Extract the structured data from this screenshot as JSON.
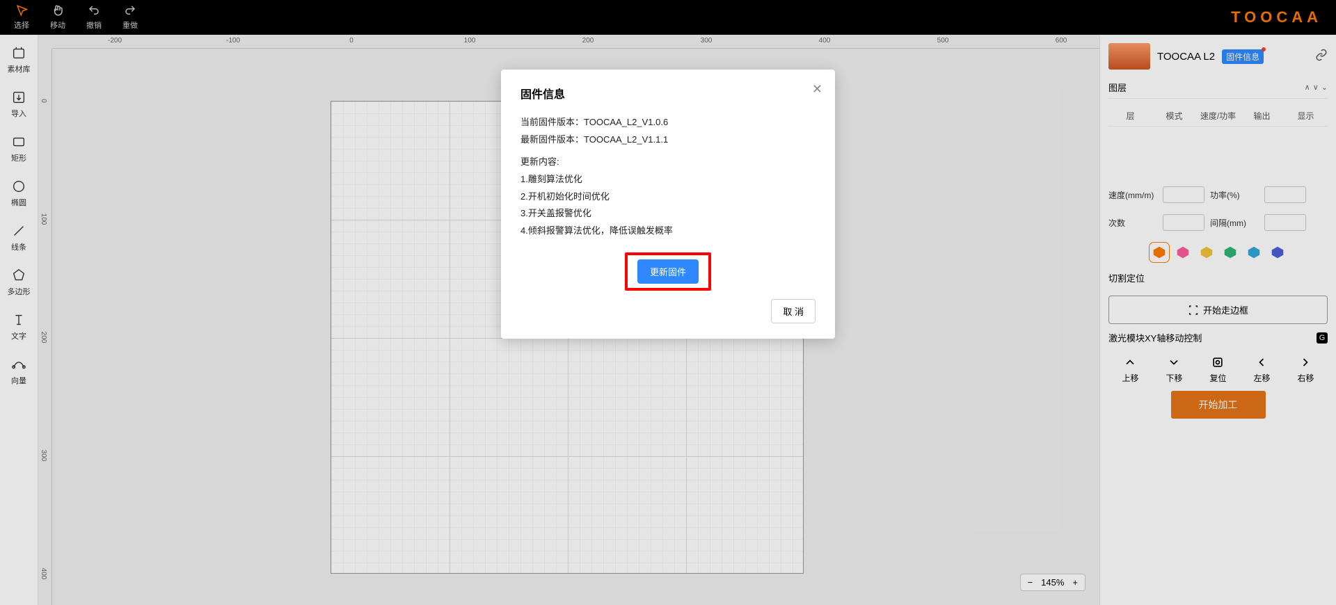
{
  "topbar": {
    "tools": [
      {
        "id": "select",
        "label": "选择"
      },
      {
        "id": "move",
        "label": "移动"
      },
      {
        "id": "undo",
        "label": "撤销"
      },
      {
        "id": "redo",
        "label": "重做"
      }
    ],
    "logo": "TOOCAA"
  },
  "leftTools": [
    {
      "id": "library",
      "label": "素材库"
    },
    {
      "id": "import",
      "label": "导入"
    },
    {
      "id": "rect",
      "label": "矩形"
    },
    {
      "id": "ellipse",
      "label": "椭圆"
    },
    {
      "id": "line",
      "label": "线条"
    },
    {
      "id": "polygon",
      "label": "多边形"
    },
    {
      "id": "text",
      "label": "文字"
    },
    {
      "id": "vector",
      "label": "向量"
    }
  ],
  "ruler": {
    "h": [
      "-200",
      "-100",
      "0",
      "100",
      "200",
      "300",
      "400",
      "500",
      "600"
    ],
    "v": [
      "0",
      "100",
      "200",
      "300",
      "400"
    ]
  },
  "zoom": {
    "level": "145%"
  },
  "device": {
    "name": "TOOCAA L2",
    "badge": "固件信息"
  },
  "layers": {
    "title": "图层",
    "cols": [
      "层",
      "模式",
      "速度/功率",
      "输出",
      "显示"
    ]
  },
  "params": {
    "speedLabel": "速度(mm/m)",
    "speedVal": "",
    "powerLabel": "功率(%)",
    "powerVal": "",
    "countLabel": "次数",
    "countVal": "",
    "gapLabel": "间隔(mm)",
    "gapVal": ""
  },
  "swatches": [
    "#FF7A00",
    "#FF5C9B",
    "#F3C13A",
    "#2DB574",
    "#2FA7D9",
    "#4B5FD6"
  ],
  "cutting": {
    "title": "切割定位",
    "frameBtn": "开始走边框"
  },
  "xy": {
    "title": "激光模块XY轴移动控制",
    "items": [
      {
        "id": "up",
        "label": "上移"
      },
      {
        "id": "down",
        "label": "下移"
      },
      {
        "id": "reset",
        "label": "复位"
      },
      {
        "id": "left",
        "label": "左移"
      },
      {
        "id": "right",
        "label": "右移"
      }
    ]
  },
  "processBtn": "开始加工",
  "modal": {
    "title": "固件信息",
    "currentLabel": "当前固件版本：",
    "currentVer": "TOOCAA_L2_V1.0.6",
    "latestLabel": "最新固件版本：",
    "latestVer": "TOOCAA_L2_V1.1.1",
    "updateHeader": "更新内容:",
    "items": [
      "1.雕刻算法优化",
      "2.开机初始化时间优化",
      "3.开关盖报警优化",
      "4.倾斜报警算法优化，降低误触发概率"
    ],
    "updateBtn": "更新固件",
    "cancelBtn": "取 消"
  }
}
